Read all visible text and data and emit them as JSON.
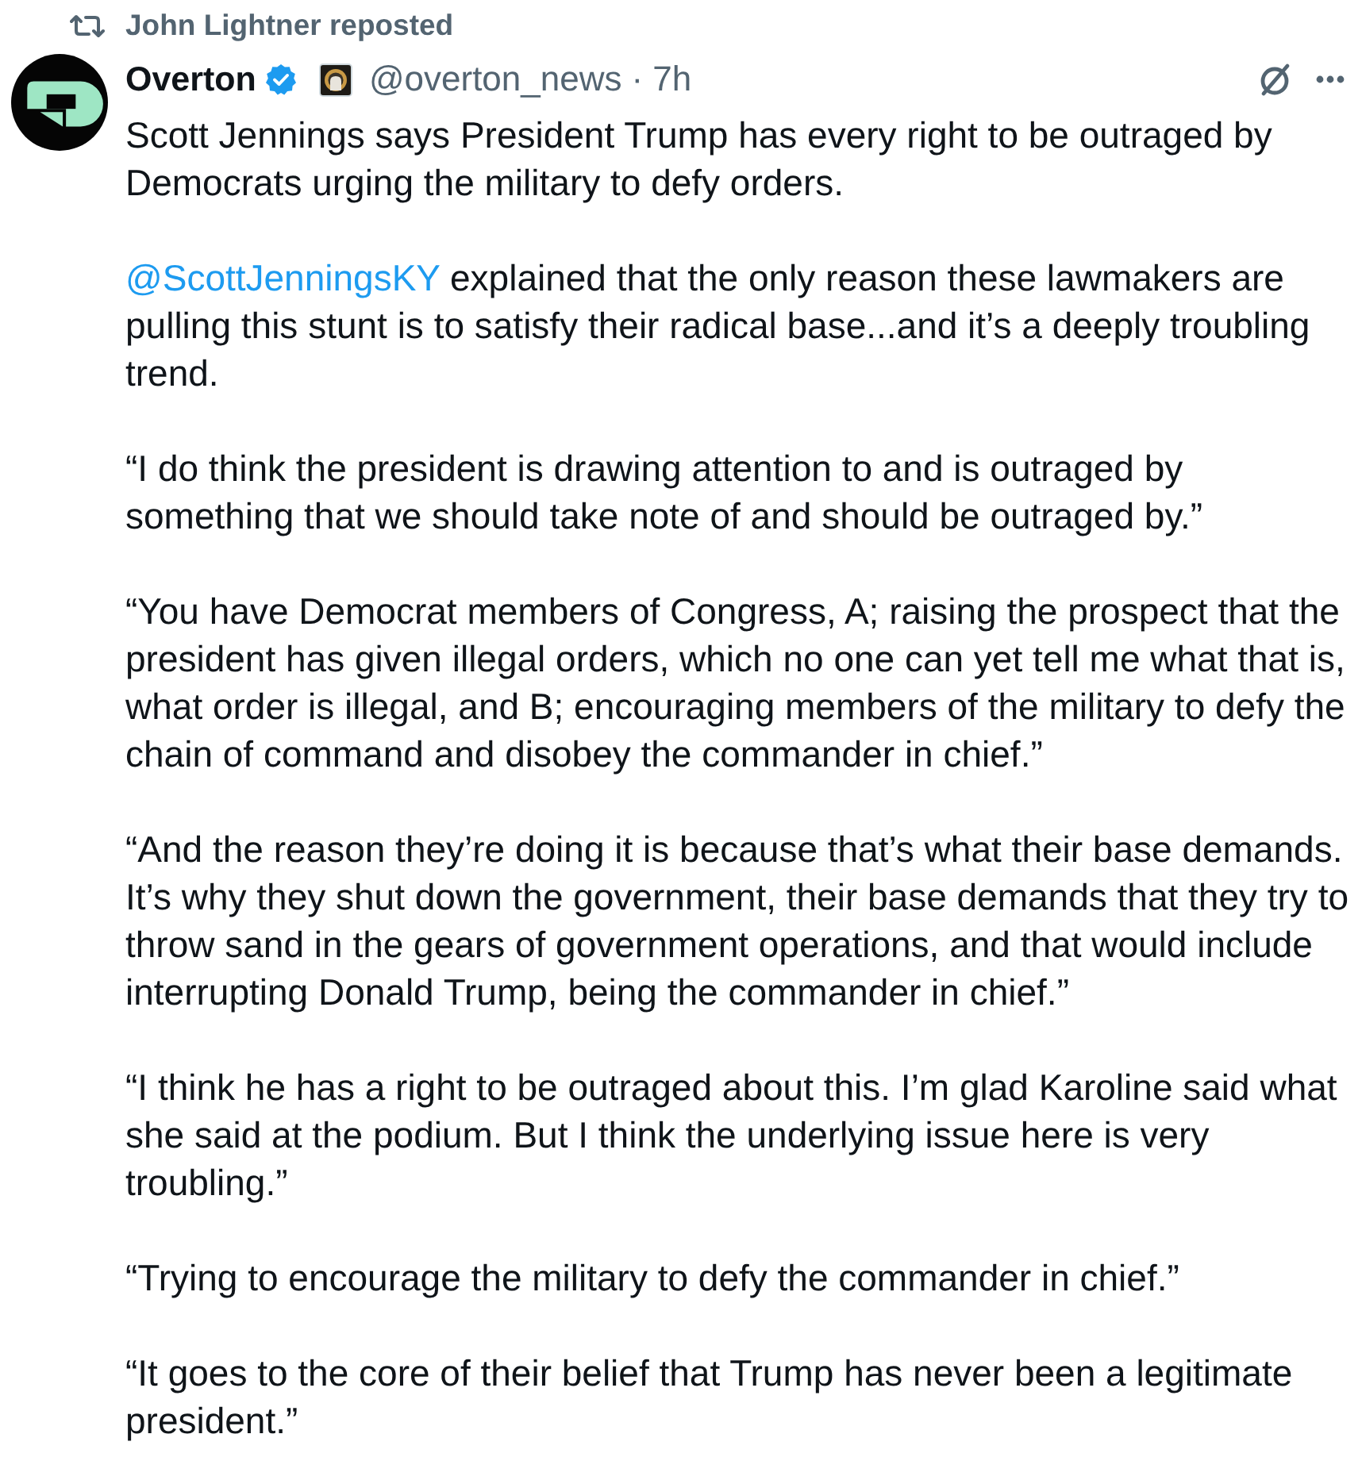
{
  "repost": {
    "label": "John Lightner reposted"
  },
  "post": {
    "author": {
      "name": "Overton",
      "verified": true,
      "affiliate_badge": true,
      "handle": "@overton_news",
      "separator": "·",
      "time": "7h"
    },
    "paragraphs": [
      {
        "segments": [
          {
            "kind": "text",
            "text": "Scott Jennings says President Trump has every right to be outraged by Democrats urging the military to defy orders."
          }
        ]
      },
      {
        "segments": [
          {
            "kind": "mention",
            "text": "@ScottJenningsKY"
          },
          {
            "kind": "text",
            "text": " explained that the only reason these lawmakers are pulling this stunt is to satisfy their radical base...and it’s a deeply troubling trend."
          }
        ]
      },
      {
        "segments": [
          {
            "kind": "text",
            "text": "“I do think the president is drawing attention to and is outraged by something that we should take note of and should be outraged by.”"
          }
        ]
      },
      {
        "segments": [
          {
            "kind": "text",
            "text": "“You have Democrat members of Congress, A; raising the prospect that the president has given illegal orders, which no one can yet tell me what that is, what order is illegal, and B; encouraging members of the military to defy the chain of command and disobey the commander in chief.”"
          }
        ]
      },
      {
        "segments": [
          {
            "kind": "text",
            "text": "“And the reason they’re doing it is because that’s what their base demands. It’s why they shut down the government, their base demands that they try to throw sand in the gears of government operations, and that would include interrupting Donald Trump, being the commander in chief.”"
          }
        ]
      },
      {
        "segments": [
          {
            "kind": "text",
            "text": "“I think he has a right to be outraged about this. I’m glad Karoline said what she said at the podium. But I think the underlying issue here is very troubling.”"
          }
        ]
      },
      {
        "segments": [
          {
            "kind": "text",
            "text": "“Trying to encourage the military to defy the commander in chief.”"
          }
        ]
      },
      {
        "segments": [
          {
            "kind": "text",
            "text": "“It goes to the core of their belief that Trump has never been a legitimate president.”"
          }
        ]
      }
    ]
  }
}
